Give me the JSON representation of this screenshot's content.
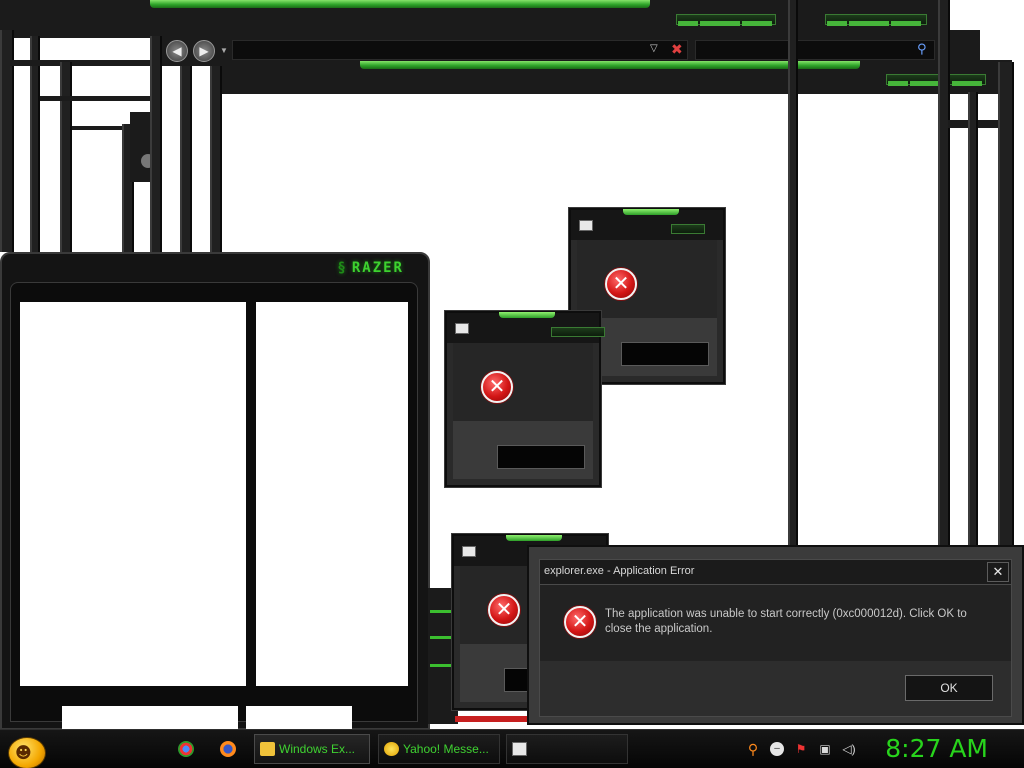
{
  "razer": {
    "logo_text": "RAZER"
  },
  "app_error": {
    "title": "explorer.exe - Application Error",
    "message": "The application was unable to start correctly (0xc000012d). Click OK to close the application.",
    "ok_label": "OK",
    "close_glyph": "✕"
  },
  "taskbar": {
    "tasks": [
      {
        "label": "Windows Ex..."
      },
      {
        "label": "Yahoo! Messe..."
      },
      {
        "label": ""
      }
    ],
    "clock": "8:27 AM"
  },
  "icons": {
    "start": "messenger-smiley-icon",
    "quicklaunch": [
      "chrome-icon",
      "firefox-icon"
    ],
    "tray": [
      "search-icon",
      "messenger-status-icon",
      "security-flag-icon",
      "network-icon",
      "volume-icon"
    ]
  },
  "colors": {
    "accent": "#3dd12f",
    "error": "#d31616",
    "taskbar": "#0a0a0a"
  }
}
